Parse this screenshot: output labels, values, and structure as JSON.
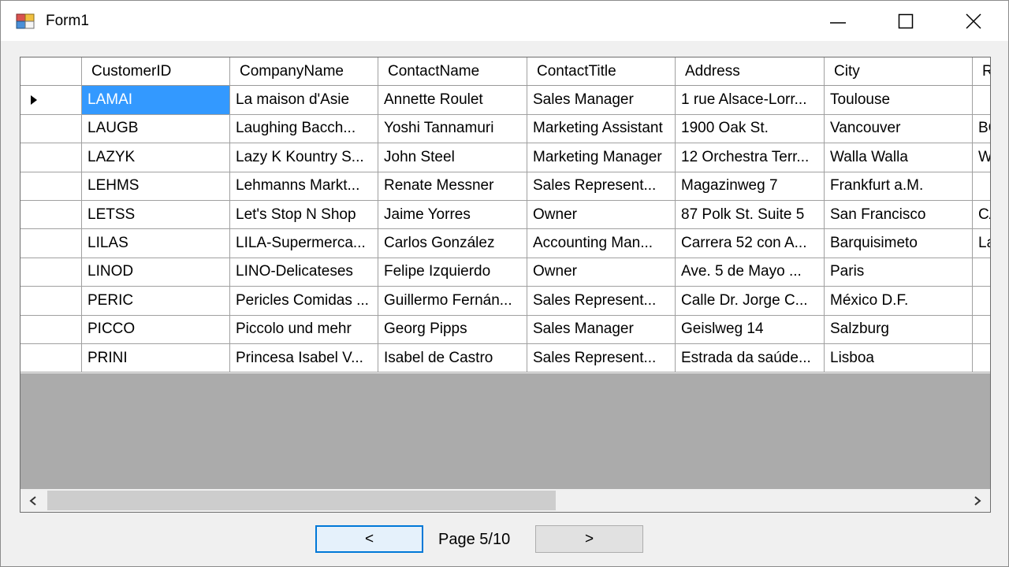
{
  "window": {
    "title": "Form1"
  },
  "grid": {
    "columns": [
      "CustomerID",
      "CompanyName",
      "ContactName",
      "ContactTitle",
      "Address",
      "City",
      "R"
    ],
    "rows": [
      [
        "LAMAI",
        "La maison d'Asie",
        "Annette Roulet",
        "Sales Manager",
        "1 rue Alsace-Lorr...",
        "Toulouse",
        ""
      ],
      [
        "LAUGB",
        "Laughing Bacch...",
        "Yoshi Tannamuri",
        "Marketing Assistant",
        "1900 Oak St.",
        "Vancouver",
        "BC"
      ],
      [
        "LAZYK",
        "Lazy K Kountry S...",
        "John Steel",
        "Marketing Manager",
        "12 Orchestra Terr...",
        "Walla Walla",
        "WA"
      ],
      [
        "LEHMS",
        "Lehmanns Markt...",
        "Renate Messner",
        "Sales Represent...",
        "Magazinweg 7",
        "Frankfurt a.M.",
        ""
      ],
      [
        "LETSS",
        "Let's Stop N Shop",
        "Jaime Yorres",
        "Owner",
        "87 Polk St. Suite 5",
        "San Francisco",
        "CA"
      ],
      [
        "LILAS",
        "LILA-Supermerca...",
        "Carlos González",
        "Accounting Man...",
        "Carrera 52 con A...",
        "Barquisimeto",
        "Lara"
      ],
      [
        "LINOD",
        "LINO-Delicateses",
        "Felipe Izquierdo",
        "Owner",
        "Ave. 5 de Mayo ...",
        "Paris",
        ""
      ],
      [
        "PERIC",
        "Pericles Comidas ...",
        "Guillermo Fernán...",
        "Sales Represent...",
        "Calle Dr. Jorge C...",
        "México D.F.",
        ""
      ],
      [
        "PICCO",
        "Piccolo und mehr",
        "Georg Pipps",
        "Sales Manager",
        "Geislweg 14",
        "Salzburg",
        ""
      ],
      [
        "PRINI",
        "Princesa Isabel V...",
        "Isabel de Castro",
        "Sales Represent...",
        "Estrada da saúde...",
        "Lisboa",
        ""
      ]
    ],
    "selected": {
      "row": 0,
      "col": 0
    }
  },
  "nav": {
    "prev_label": "<",
    "next_label": ">",
    "page_label": "Page 5/10"
  },
  "colors": {
    "selection": "#3399ff",
    "focus_border": "#0078d7",
    "empty_area": "#ababab"
  },
  "icons": [
    "app-icon",
    "minimize-icon",
    "maximize-icon",
    "close-icon",
    "row-indicator-icon",
    "scroll-left-icon",
    "scroll-right-icon"
  ]
}
